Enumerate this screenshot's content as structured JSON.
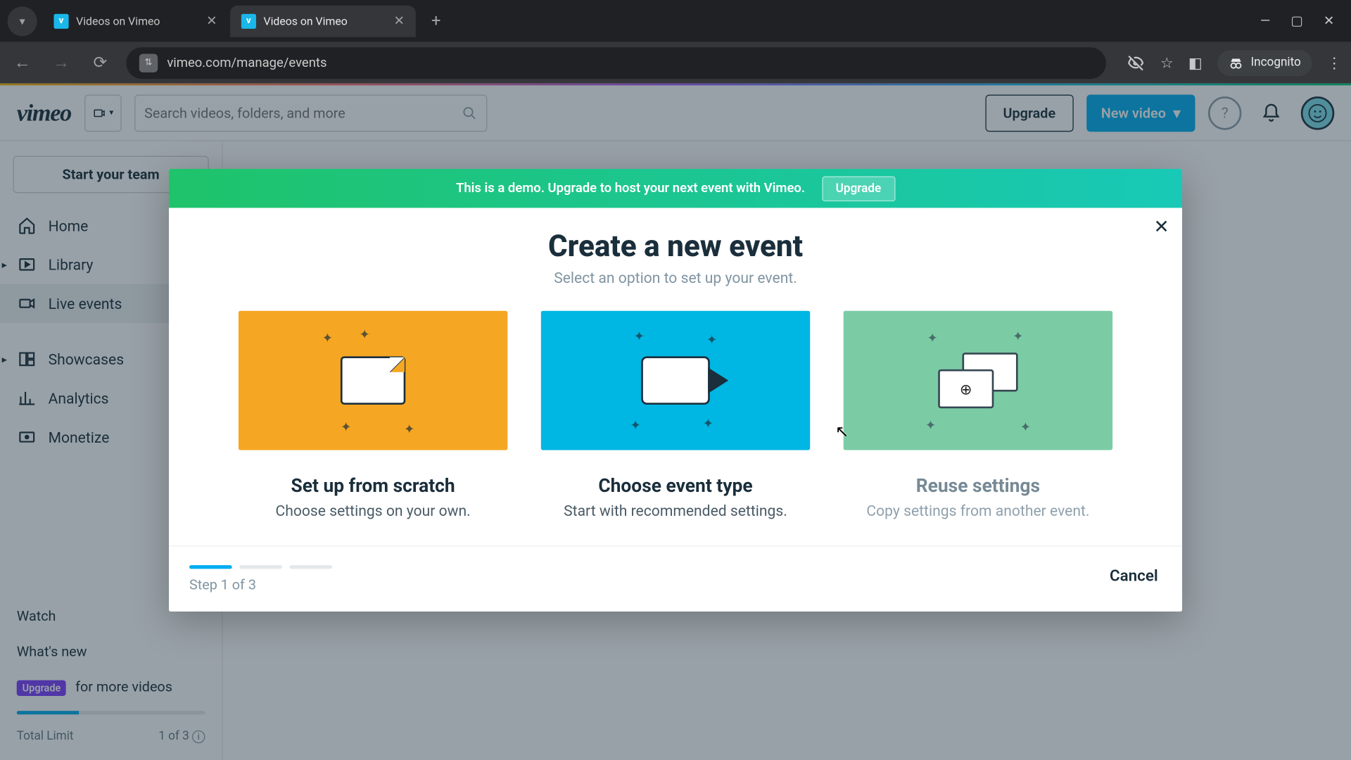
{
  "browser": {
    "tabs": [
      {
        "title": "Videos on Vimeo",
        "active": false
      },
      {
        "title": "Videos on Vimeo",
        "active": true
      }
    ],
    "url": "vimeo.com/manage/events",
    "incognito_label": "Incognito"
  },
  "topbar": {
    "logo": "vimeo",
    "search_placeholder": "Search videos, folders, and more",
    "upgrade_label": "Upgrade",
    "new_video_label": "New video"
  },
  "sidebar": {
    "team_button": "Start your team",
    "items": [
      {
        "label": "Home",
        "expandable": false,
        "active": false
      },
      {
        "label": "Library",
        "expandable": true,
        "active": false
      },
      {
        "label": "Live events",
        "expandable": false,
        "active": true
      },
      {
        "label": "Showcases",
        "expandable": true,
        "active": false
      },
      {
        "label": "Analytics",
        "expandable": false,
        "active": false
      },
      {
        "label": "Monetize",
        "expandable": false,
        "active": false
      }
    ],
    "watch_label": "Watch",
    "whatsnew_label": "What's new",
    "upgrade_tag": "Upgrade",
    "upgrade_text": "for more videos",
    "limit_label": "Total Limit",
    "limit_value": "1 of 3"
  },
  "modal": {
    "banner_text": "This is a demo. Upgrade to host your next event with Vimeo.",
    "banner_button": "Upgrade",
    "title": "Create a new event",
    "subtitle": "Select an option to set up your event.",
    "cards": [
      {
        "title": "Set up from scratch",
        "desc": "Choose settings on your own."
      },
      {
        "title": "Choose event type",
        "desc": "Start with recommended settings."
      },
      {
        "title": "Reuse settings",
        "desc": "Copy settings from another event."
      }
    ],
    "step_label": "Step 1 of 3",
    "cancel_label": "Cancel"
  }
}
